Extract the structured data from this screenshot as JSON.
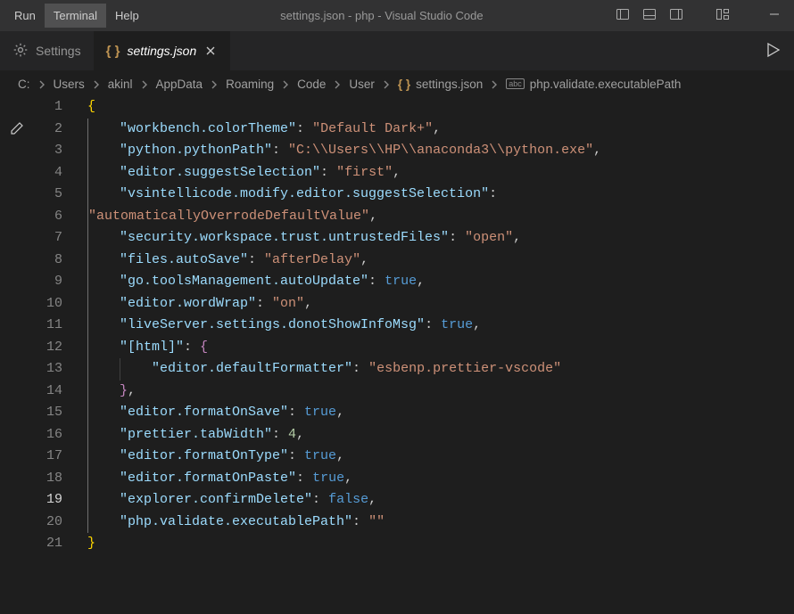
{
  "menubar": {
    "run": "Run",
    "terminal": "Terminal",
    "help": "Help"
  },
  "title": "settings.json - php - Visual Studio Code",
  "tabs": {
    "settings": "Settings",
    "file": "settings.json"
  },
  "breadcrumbs": {
    "segs": [
      "C:",
      "Users",
      "akinl",
      "AppData",
      "Roaming",
      "Code",
      "User"
    ],
    "file": "settings.json",
    "symbol": "php.validate.executablePath"
  },
  "code": {
    "lines": [
      {
        "n": 1,
        "tokens": [
          [
            "brace",
            "{"
          ]
        ]
      },
      {
        "n": 2,
        "tokens": [
          [
            "pad",
            "    "
          ],
          [
            "key",
            "\"workbench.colorTheme\""
          ],
          [
            "punct",
            ": "
          ],
          [
            "str",
            "\"Default Dark+\""
          ],
          [
            "punct",
            ","
          ]
        ]
      },
      {
        "n": 3,
        "tokens": [
          [
            "pad",
            "    "
          ],
          [
            "key",
            "\"python.pythonPath\""
          ],
          [
            "punct",
            ": "
          ],
          [
            "str",
            "\"C:\\\\Users\\\\HP\\\\anaconda3\\\\python.exe\""
          ],
          [
            "punct",
            ","
          ]
        ]
      },
      {
        "n": 4,
        "tokens": [
          [
            "pad",
            "    "
          ],
          [
            "key",
            "\"editor.suggestSelection\""
          ],
          [
            "punct",
            ": "
          ],
          [
            "str",
            "\"first\""
          ],
          [
            "punct",
            ","
          ]
        ]
      },
      {
        "n": 5,
        "tokens": [
          [
            "pad",
            "    "
          ],
          [
            "key",
            "\"vsintellicode.modify.editor.suggestSelection\""
          ],
          [
            "punct",
            ": "
          ]
        ]
      },
      {
        "n": "",
        "tokens": [
          [
            "str",
            "\"automaticallyOverrodeDefaultValue\""
          ],
          [
            "punct",
            ","
          ]
        ],
        "wrap": true
      },
      {
        "n": 6,
        "tokens": [
          [
            "pad",
            "    "
          ],
          [
            "key",
            "\"security.workspace.trust.untrustedFiles\""
          ],
          [
            "punct",
            ": "
          ],
          [
            "str",
            "\"open\""
          ],
          [
            "punct",
            ","
          ]
        ]
      },
      {
        "n": 7,
        "tokens": [
          [
            "pad",
            "    "
          ],
          [
            "key",
            "\"files.autoSave\""
          ],
          [
            "punct",
            ": "
          ],
          [
            "str",
            "\"afterDelay\""
          ],
          [
            "punct",
            ","
          ]
        ]
      },
      {
        "n": 8,
        "tokens": [
          [
            "pad",
            "    "
          ],
          [
            "key",
            "\"go.toolsManagement.autoUpdate\""
          ],
          [
            "punct",
            ": "
          ],
          [
            "kw",
            "true"
          ],
          [
            "punct",
            ","
          ]
        ]
      },
      {
        "n": 9,
        "tokens": [
          [
            "pad",
            "    "
          ],
          [
            "key",
            "\"editor.wordWrap\""
          ],
          [
            "punct",
            ": "
          ],
          [
            "str",
            "\"on\""
          ],
          [
            "punct",
            ","
          ]
        ]
      },
      {
        "n": 10,
        "tokens": [
          [
            "pad",
            "    "
          ],
          [
            "key",
            "\"liveServer.settings.donotShowInfoMsg\""
          ],
          [
            "punct",
            ": "
          ],
          [
            "kw",
            "true"
          ],
          [
            "punct",
            ","
          ]
        ]
      },
      {
        "n": 11,
        "tokens": [
          [
            "pad",
            "    "
          ],
          [
            "key",
            "\"[html]\""
          ],
          [
            "punct",
            ": "
          ],
          [
            "brace2",
            "{"
          ]
        ]
      },
      {
        "n": 12,
        "tokens": [
          [
            "pad",
            "        "
          ],
          [
            "key",
            "\"editor.defaultFormatter\""
          ],
          [
            "punct",
            ": "
          ],
          [
            "str",
            "\"esbenp.prettier-vscode\""
          ]
        ]
      },
      {
        "n": 13,
        "tokens": [
          [
            "pad",
            "    "
          ],
          [
            "brace2",
            "}"
          ],
          [
            "punct",
            ","
          ]
        ]
      },
      {
        "n": 14,
        "tokens": [
          [
            "pad",
            "    "
          ],
          [
            "key",
            "\"editor.formatOnSave\""
          ],
          [
            "punct",
            ": "
          ],
          [
            "kw",
            "true"
          ],
          [
            "punct",
            ","
          ]
        ]
      },
      {
        "n": 15,
        "tokens": [
          [
            "pad",
            "    "
          ],
          [
            "key",
            "\"prettier.tabWidth\""
          ],
          [
            "punct",
            ": "
          ],
          [
            "num",
            "4"
          ],
          [
            "punct",
            ","
          ]
        ]
      },
      {
        "n": 16,
        "tokens": [
          [
            "pad",
            "    "
          ],
          [
            "key",
            "\"editor.formatOnType\""
          ],
          [
            "punct",
            ": "
          ],
          [
            "kw",
            "true"
          ],
          [
            "punct",
            ","
          ]
        ]
      },
      {
        "n": 17,
        "tokens": [
          [
            "pad",
            "    "
          ],
          [
            "key",
            "\"editor.formatOnPaste\""
          ],
          [
            "punct",
            ": "
          ],
          [
            "kw",
            "true"
          ],
          [
            "punct",
            ","
          ]
        ]
      },
      {
        "n": 18,
        "tokens": [
          [
            "pad",
            "    "
          ],
          [
            "key",
            "\"explorer.confirmDelete\""
          ],
          [
            "punct",
            ": "
          ],
          [
            "kw",
            "false"
          ],
          [
            "punct",
            ","
          ]
        ]
      },
      {
        "n": 19,
        "tokens": [
          [
            "pad",
            "    "
          ],
          [
            "key",
            "\"php.validate.executablePath\""
          ],
          [
            "punct",
            ": "
          ],
          [
            "str",
            "\"\""
          ]
        ],
        "active": true
      },
      {
        "n": 20,
        "tokens": [
          [
            "brace",
            "}"
          ]
        ]
      },
      {
        "n": 21,
        "tokens": []
      }
    ]
  },
  "colors": {
    "num": "#b5cea8"
  }
}
